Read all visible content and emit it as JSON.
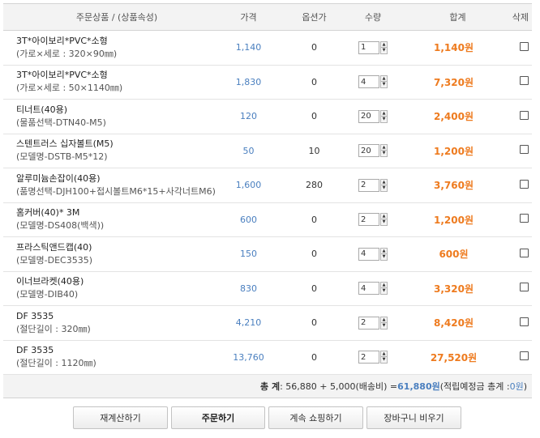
{
  "header": {
    "name": "주문상품 / (상품속성)",
    "price": "가격",
    "option": "옵션가",
    "qty": "수량",
    "sum": "합계",
    "del": "삭제"
  },
  "items": [
    {
      "name": "3T*아이보리*PVC*소형",
      "desc": "(가로×세로 : 320×90㎜)",
      "price": "1,140",
      "option": "0",
      "qty": "1",
      "sum": "1,140원"
    },
    {
      "name": "3T*아이보리*PVC*소형",
      "desc": "(가로×세로 : 50×1140㎜)",
      "price": "1,830",
      "option": "0",
      "qty": "4",
      "sum": "7,320원"
    },
    {
      "name": "티너트(40용)",
      "desc": "(물품선택-DTN40-M5)",
      "price": "120",
      "option": "0",
      "qty": "20",
      "sum": "2,400원"
    },
    {
      "name": "스텐트러스 십자볼트(M5)",
      "desc": "(모델명-DSTB-M5*12)",
      "price": "50",
      "option": "10",
      "qty": "20",
      "sum": "1,200원"
    },
    {
      "name": "알루미늄손잡이(40용)",
      "desc": "(품명선택-DJH100+접시볼트M6*15+사각너트M6)",
      "price": "1,600",
      "option": "280",
      "qty": "2",
      "sum": "3,760원"
    },
    {
      "name": "홈커버(40)* 3M",
      "desc": "(모델명-DS408(백색))",
      "price": "600",
      "option": "0",
      "qty": "2",
      "sum": "1,200원"
    },
    {
      "name": "프라스틱앤드캡(40)",
      "desc": "(모델명-DEC3535)",
      "price": "150",
      "option": "0",
      "qty": "4",
      "sum": "600원"
    },
    {
      "name": "이너브라켓(40용)",
      "desc": "(모델명-DIB40)",
      "price": "830",
      "option": "0",
      "qty": "4",
      "sum": "3,320원"
    },
    {
      "name": "DF 3535",
      "desc": "(절단길이 : 320㎜)",
      "price": "4,210",
      "option": "0",
      "qty": "2",
      "sum": "8,420원"
    },
    {
      "name": "DF 3535",
      "desc": "(절단길이 : 1120㎜)",
      "price": "13,760",
      "option": "0",
      "qty": "2",
      "sum": "27,520원"
    }
  ],
  "total": {
    "label": "총 계",
    "formula": " : 56,880 + 5,000(배송비) = ",
    "amount": "61,880원",
    "points_prefix": " (적립예정금 총계 : ",
    "points": "0원",
    "points_suffix": ")"
  },
  "buttons": {
    "recalc": "재계산하기",
    "order": "주문하기",
    "continue": "계속 쇼핑하기",
    "empty": "장바구니 비우기"
  },
  "colors": {
    "price": "#4a7fbf",
    "sum": "#ee7b1f",
    "header_bg": "#f3f3f3"
  }
}
